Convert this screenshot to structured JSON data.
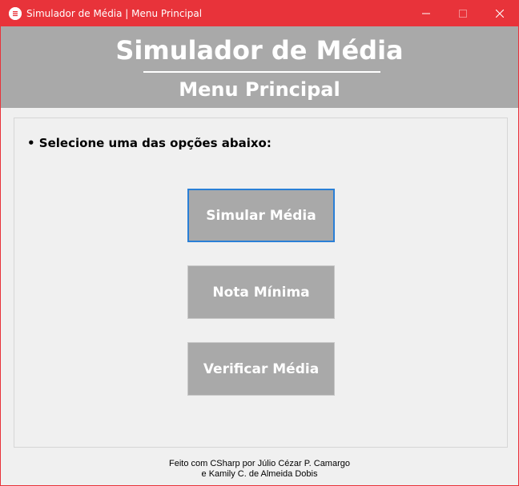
{
  "window": {
    "title": "Simulador de Média | Menu Principal"
  },
  "header": {
    "title": "Simulador de Média",
    "subtitle": "Menu Principal"
  },
  "main": {
    "instruction": "• Selecione uma das opções abaixo:",
    "buttons": [
      {
        "label": "Simular Média"
      },
      {
        "label": "Nota Mínima"
      },
      {
        "label": "Verificar Média"
      }
    ]
  },
  "footer": {
    "line1": "Feito com CSharp por Júlio Cézar P. Camargo",
    "line2": "e Kamily C. de Almeida Dobis"
  },
  "colors": {
    "titlebar": "#e8333a",
    "header_bg": "#a9a9a9",
    "button_bg": "#a9a9a9",
    "focus_border": "#2a7fd6"
  },
  "icons": {
    "app": "list-icon",
    "minimize": "minimize-icon",
    "maximize": "maximize-icon",
    "close": "close-icon"
  }
}
